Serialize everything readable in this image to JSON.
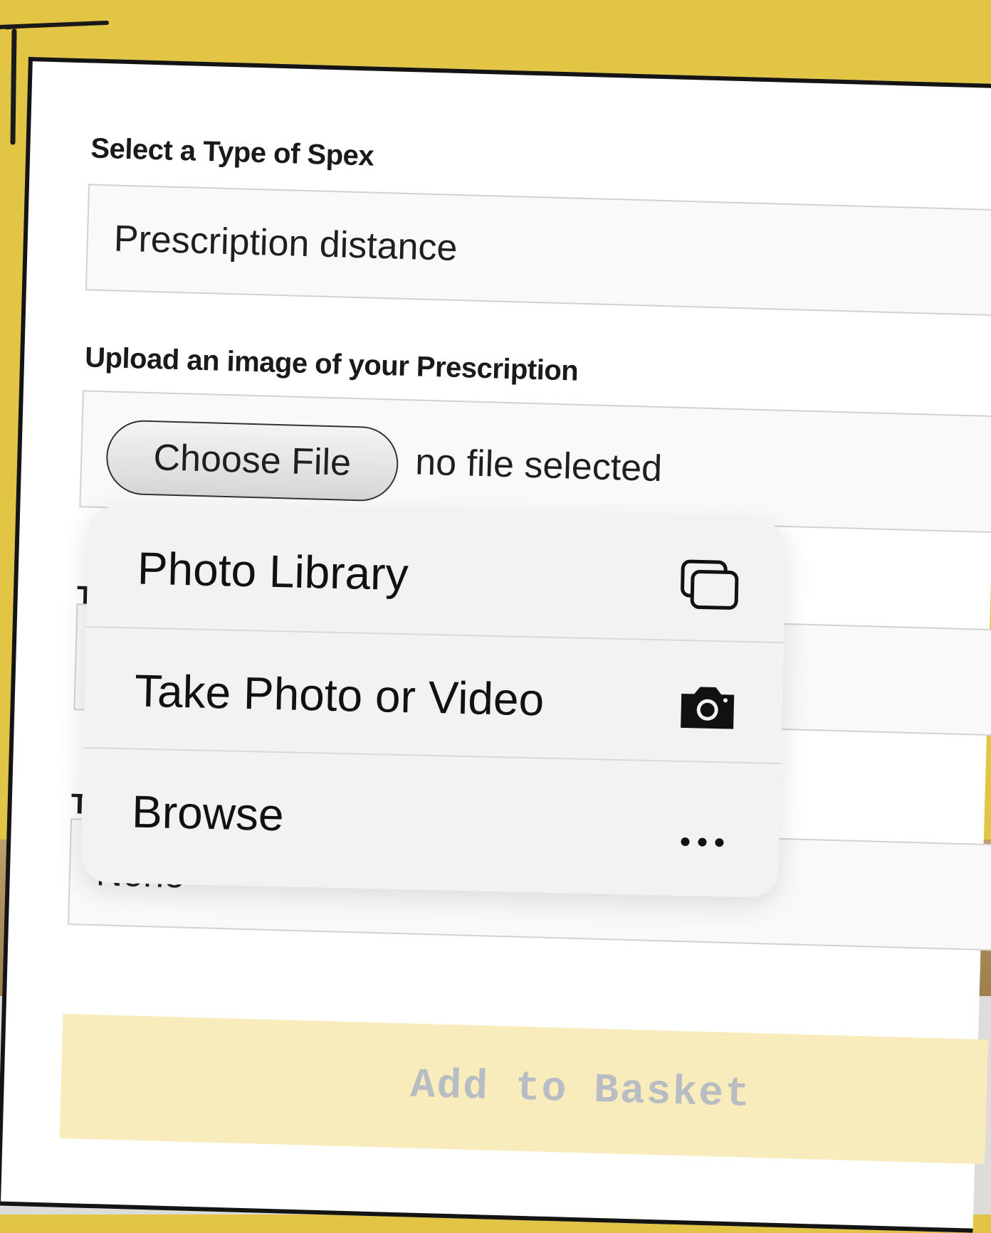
{
  "form": {
    "type_label": "Select a Type of Spex",
    "type_value": "Prescription distance",
    "upload_label": "Upload an image of your Prescription",
    "choose_file_label": "Choose File",
    "file_status": "no file selected",
    "tint_label_partial": "Ti",
    "third_label_partial": "Tl",
    "third_value": "None",
    "add_to_basket_label": "Add to Basket"
  },
  "menu": {
    "items": [
      {
        "label": "Photo Library",
        "icon": "photo-library-icon"
      },
      {
        "label": "Take Photo or Video",
        "icon": "camera-icon"
      },
      {
        "label": "Browse",
        "icon": "more-ellipsis-icon"
      }
    ]
  },
  "colors": {
    "background_yellow": "#e2c544",
    "card_border": "#141414",
    "add_basket_bg": "#f8ecbc",
    "add_basket_text": "#b7bdc3",
    "menu_bg": "#f2f2f2"
  }
}
